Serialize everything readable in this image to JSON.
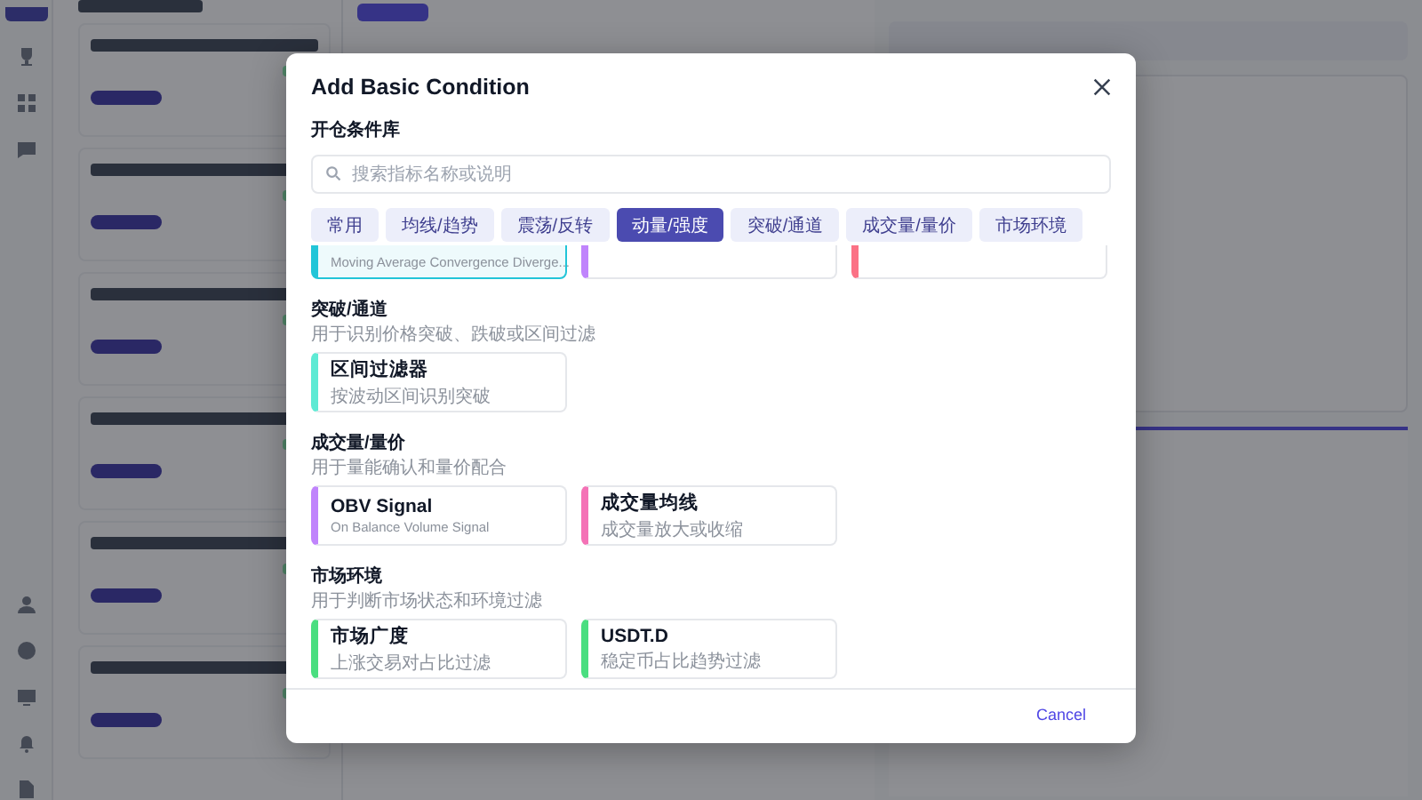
{
  "modal": {
    "title": "Add Basic Condition",
    "library_label": "开仓条件库",
    "search": {
      "placeholder": "搜索指标名称或说明"
    },
    "tabs": [
      {
        "label": "常用",
        "selected": false
      },
      {
        "label": "均线/趋势",
        "selected": false
      },
      {
        "label": "震荡/反转",
        "selected": false
      },
      {
        "label": "动量/强度",
        "selected": true
      },
      {
        "label": "突破/通道",
        "selected": false
      },
      {
        "label": "成交量/量价",
        "selected": false
      },
      {
        "label": "市场环境",
        "selected": false
      }
    ],
    "partial_cards": [
      {
        "subtitle": "Moving Average Convergence Diverge...",
        "color": "#22c5d8",
        "selected": true
      },
      {
        "color": "#c084fc",
        "selected": false
      },
      {
        "color": "#fb7185",
        "selected": false
      }
    ],
    "sections": [
      {
        "title": "突破/通道",
        "description": "用于识别价格突破、跌破或区间过滤",
        "cards": [
          {
            "title": "区间过滤器",
            "subtitle": "按波动区间识别突破",
            "color": "#5eead4",
            "selected": false
          }
        ]
      },
      {
        "title": "成交量/量价",
        "description": "用于量能确认和量价配合",
        "cards": [
          {
            "title": "OBV Signal",
            "subtitle": "On Balance Volume Signal",
            "color": "#c084fc",
            "selected": false
          },
          {
            "title": "成交量均线",
            "subtitle": "成交量放大或收缩",
            "color": "#f472b6",
            "selected": false
          }
        ]
      },
      {
        "title": "市场环境",
        "description": "用于判断市场状态和环境过滤",
        "cards": [
          {
            "title": "市场广度",
            "subtitle": "上涨交易对占比过滤",
            "color": "#4ade80",
            "selected": false
          },
          {
            "title": "USDT.D",
            "subtitle": "稳定币占比趋势过滤",
            "color": "#4ade80",
            "selected": false
          }
        ]
      }
    ],
    "cancel": "Cancel"
  }
}
